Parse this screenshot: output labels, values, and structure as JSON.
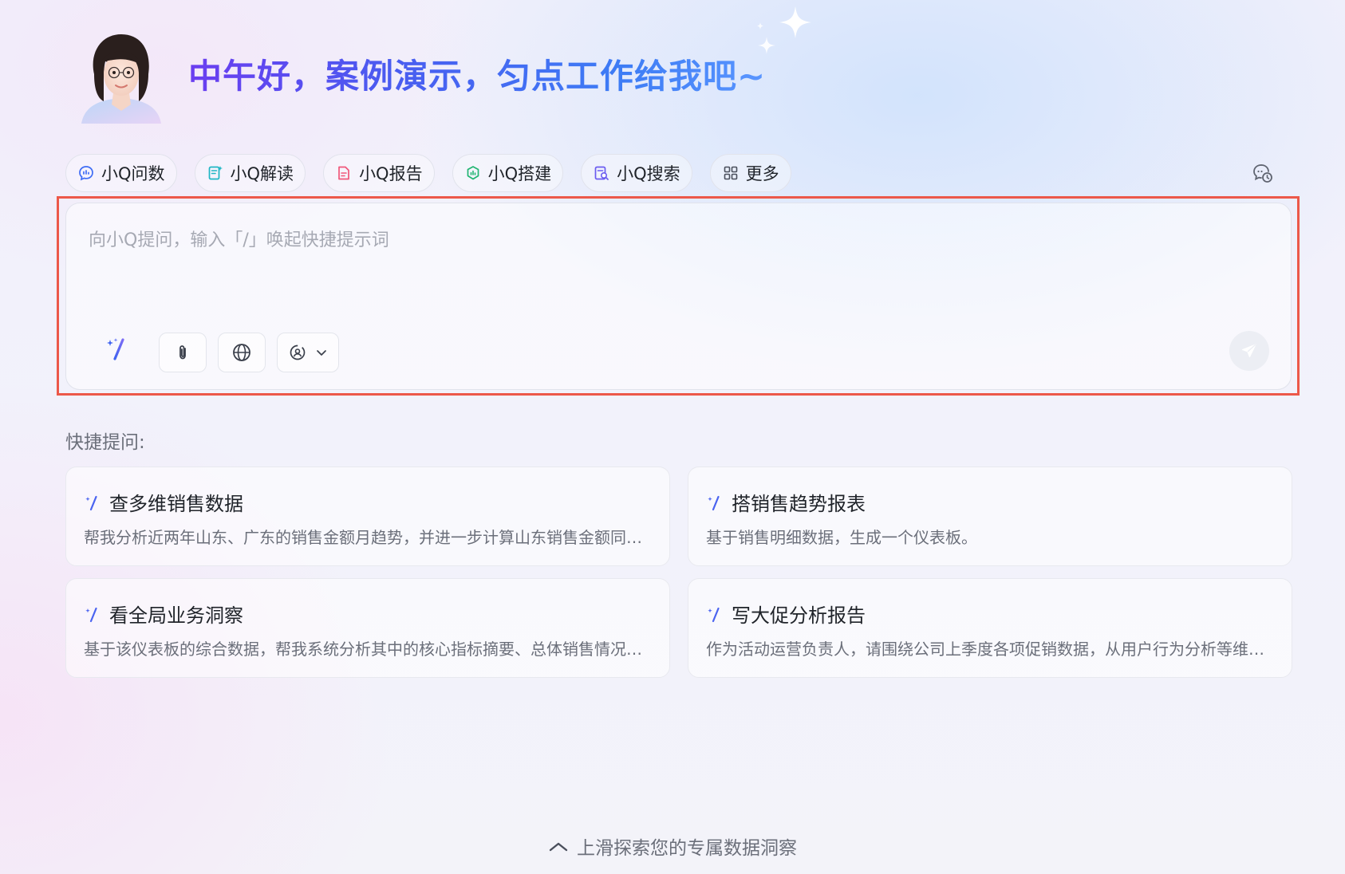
{
  "greeting": "中午好，案例演示，匀点工作给我吧~",
  "tools": [
    {
      "label": "小Q问数",
      "icon": "chat-data-icon",
      "color": "#3e6cf5"
    },
    {
      "label": "小Q解读",
      "icon": "document-read-icon",
      "color": "#1fb6c4"
    },
    {
      "label": "小Q报告",
      "icon": "report-icon",
      "color": "#f0577a"
    },
    {
      "label": "小Q搭建",
      "icon": "dashboard-build-icon",
      "color": "#22b573"
    },
    {
      "label": "小Q搜索",
      "icon": "search-doc-icon",
      "color": "#6b5cf0"
    },
    {
      "label": "更多",
      "icon": "grid-more-icon",
      "color": "#4a4f5c"
    }
  ],
  "input": {
    "placeholder": "向小Q提问，输入「/」唤起快捷提示词"
  },
  "quick": {
    "title": "快捷提问:",
    "cards": [
      {
        "title": "查多维销售数据",
        "desc": "帮我分析近两年山东、广东的销售金额月趋势，并进一步计算山东销售金额同比增长率"
      },
      {
        "title": "搭销售趋势报表",
        "desc": "基于销售明细数据，生成一个仪表板。"
      },
      {
        "title": "看全局业务洞察",
        "desc": "基于该仪表板的综合数据，帮我系统分析其中的核心指标摘要、总体销售情况和主要问题"
      },
      {
        "title": "写大促分析报告",
        "desc": "作为活动运营负责人，请围绕公司上季度各项促销数据，从用户行为分析等维度撰写报告"
      }
    ]
  },
  "footer": {
    "hint": "上滑探索您的专属数据洞察"
  },
  "colors": {
    "accent": "#4a5cf0",
    "highlight_border": "#ec5849"
  }
}
